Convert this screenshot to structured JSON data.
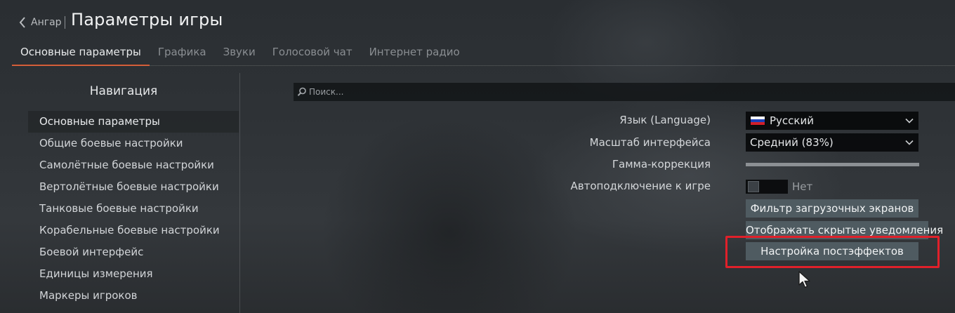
{
  "header": {
    "back_label": "Ангар",
    "title": "Параметры игры"
  },
  "tabs": [
    {
      "label": "Основные параметры",
      "active": true
    },
    {
      "label": "Графика",
      "active": false
    },
    {
      "label": "Звуки",
      "active": false
    },
    {
      "label": "Голосовой чат",
      "active": false
    },
    {
      "label": "Интернет радио",
      "active": false
    }
  ],
  "nav": {
    "title": "Навигация",
    "items": [
      {
        "label": "Основные параметры",
        "selected": true
      },
      {
        "label": "Общие боевые настройки"
      },
      {
        "label": "Самолётные боевые настройки"
      },
      {
        "label": "Вертолётные боевые настройки"
      },
      {
        "label": "Танковые боевые настройки"
      },
      {
        "label": "Корабельные боевые настройки"
      },
      {
        "label": "Боевой интерфейс"
      },
      {
        "label": "Единицы измерения"
      },
      {
        "label": "Маркеры игроков"
      }
    ]
  },
  "search": {
    "placeholder": "Поиск..."
  },
  "settings": {
    "language": {
      "label": "Язык (Language)",
      "value": "Русский",
      "flag_colors": [
        "#ffffff",
        "#1c3fb8",
        "#d21f2a"
      ]
    },
    "ui_scale": {
      "label": "Масштаб интерфейса",
      "value": "Средний (83%)"
    },
    "gamma": {
      "label": "Гамма-коррекция",
      "level": 1.0
    },
    "autoconnect": {
      "label": "Автоподключение к игре",
      "value": "Нет",
      "on": false
    }
  },
  "buttons": {
    "loading_filter": "Фильтр загрузочных экранов",
    "show_hidden": "Отображать скрытые уведомления",
    "postfx": "Настройка постэффектов"
  },
  "colors": {
    "accent": "#d1532b",
    "button": "#4f5b61",
    "highlight": "#e0202a"
  },
  "icons": {
    "back": "chevron-left-icon",
    "search": "search-icon",
    "dropdown": "chevron-down-icon",
    "cursor": "mouse-cursor-icon"
  }
}
